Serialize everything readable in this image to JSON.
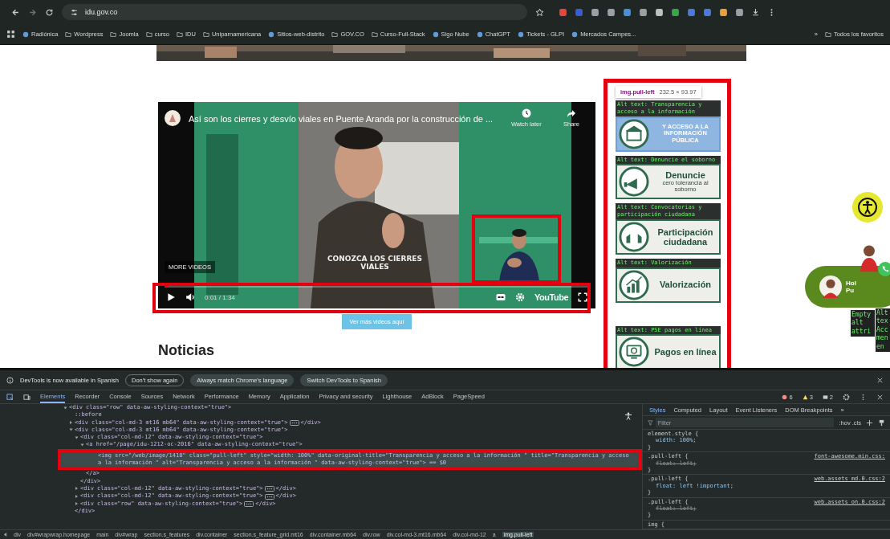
{
  "browser": {
    "url": "idu.gov.co",
    "bookmarks": [
      {
        "label": "Radiónica",
        "kind": "site"
      },
      {
        "label": "Wordpress",
        "kind": "folder"
      },
      {
        "label": "Joomla",
        "kind": "folder"
      },
      {
        "label": "curso",
        "kind": "folder"
      },
      {
        "label": "IDU",
        "kind": "folder"
      },
      {
        "label": "Uniparnamericana",
        "kind": "folder"
      },
      {
        "label": "Sitios-web-distrito",
        "kind": "site"
      },
      {
        "label": "GOV.CO",
        "kind": "folder"
      },
      {
        "label": "Curso-Full-Stack",
        "kind": "folder"
      },
      {
        "label": "Sigo Nube",
        "kind": "site"
      },
      {
        "label": "ChatGPT",
        "kind": "site"
      },
      {
        "label": "Tickets - GLPI",
        "kind": "site"
      },
      {
        "label": "Mercados Campes...",
        "kind": "site"
      }
    ],
    "overflow": "»",
    "all_bookmarks": "Todos los favoritos"
  },
  "page": {
    "video": {
      "title": "Así son los cierres y desvío viales en Puente Aranda por la construcción de ...",
      "watch_later": "Watch later",
      "share": "Share",
      "more_videos": "MORE VIDEOS",
      "caption": "CONOZCA LOS CIERRES VIALES",
      "time": "0:01 / 1:34",
      "brand": "YouTube",
      "level": 0.01
    },
    "more_button": "Ver más videos aquí",
    "heading": "Noticias",
    "inspector_tooltip": {
      "selector": "img.pull-left",
      "size": "232.5 × 93.97"
    },
    "cards": [
      {
        "alt": "Alt text: Transparencia y acceso a la información",
        "subtitle": "Y ACCESO A LA INFORMACIÓN PÚBLICA",
        "selected": true
      },
      {
        "alt": "Alt text: Denuncie el soborno",
        "title": "Denuncie",
        "subtitle": "cero tolerancia al soborno",
        "selected": false
      },
      {
        "alt": "Alt text: Convocatorias y participación ciudadana",
        "title": "Participación ciudadana",
        "selected": false
      },
      {
        "alt": "Alt text: Valorización",
        "title": "Valorización",
        "selected": false
      },
      {
        "alt": "Alt text: PSE pagos en línea",
        "title": "Pagos en línea",
        "selected": false
      }
    ],
    "chat": {
      "greeting": "Hol",
      "line": "Pu",
      "overlays": [
        "Empty alt attri",
        "Alt tex Acc men en"
      ]
    }
  },
  "devtools": {
    "notice": {
      "text": "DevTools is now available in Spanish",
      "buttons": [
        "Don't show again",
        "Always match Chrome's language",
        "Switch DevTools to Spanish"
      ]
    },
    "tabs": [
      {
        "label": "Elements",
        "selected": true
      },
      {
        "label": "Recorder",
        "selected": false
      },
      {
        "label": "Console",
        "selected": false
      },
      {
        "label": "Sources",
        "selected": false
      },
      {
        "label": "Network",
        "selected": false
      },
      {
        "label": "Performance",
        "selected": false
      },
      {
        "label": "Memory",
        "selected": false
      },
      {
        "label": "Application",
        "selected": false
      },
      {
        "label": "Privacy and security",
        "selected": false
      },
      {
        "label": "Lighthouse",
        "selected": false
      },
      {
        "label": "AdBlock",
        "selected": false
      },
      {
        "label": "PageSpeed",
        "selected": false
      }
    ],
    "errors": "6",
    "warnings": "3",
    "infos": "2",
    "dom": [
      {
        "open": "<div class=\"row\" data-aw-styling-context=\"true\">",
        "expanded": true,
        "selected": false,
        "children": [
          {
            "open": "::before",
            "selected": false
          },
          {
            "open": "<div class=\"col-md-3 mt16 mb64\" data-aw-styling-context=\"true\">",
            "close": "</div>",
            "expanded": false,
            "selected": false
          },
          {
            "open": "<div class=\"col-md-3 mt16 mb64\" data-aw-styling-context=\"true\">",
            "close": "</div>",
            "expanded": true,
            "selected": false,
            "children": [
              {
                "open": "<div class=\"col-md-12\" data-aw-styling-context=\"true\">",
                "close": "</div>",
                "expanded": true,
                "selected": false,
                "children": [
                  {
                    "open": "<a href=\"/page/idu-1212-oc-2016\" data-aw-styling-context=\"true\">",
                    "close": "</a>",
                    "expanded": true,
                    "selected": false,
                    "children": [
                      {
                        "open": "<img src=\"/web/image/1418\" class=\"pull-left\" style=\"width: 100%\" data-original-title=\"Transparencia y acceso a la información \" title=\"Transparencia y acceso a la información \" alt=\"Transparencia y acceso a la información \" data-aw-styling-context=\"true\"> == $0",
                        "selected": true
                      }
                    ]
                  }
                ]
              },
              {
                "open": "<div class=\"col-md-12\" data-aw-styling-context=\"true\">",
                "close": "</div>",
                "expanded": false,
                "selected": false
              },
              {
                "open": "<div class=\"col-md-12\" data-aw-styling-context=\"true\">",
                "close": "</div>",
                "expanded": false,
                "selected": false
              },
              {
                "open": "<div class=\"row\" data-aw-styling-context=\"true\">",
                "close": "</div>",
                "expanded": false,
                "selected": false
              }
            ]
          }
        ]
      }
    ],
    "styles_tabs": [
      {
        "label": "Styles",
        "selected": true
      },
      {
        "label": "Computed",
        "selected": false
      },
      {
        "label": "Layout",
        "selected": false
      },
      {
        "label": "Event Listeners",
        "selected": false
      },
      {
        "label": "DOM Breakpoints",
        "selected": false
      }
    ],
    "more_tabs": "»",
    "filter_placeholder": "Filter",
    "filter_tools": ":hov .cls",
    "rules": [
      {
        "open": "element.style {",
        "declarations": [
          {
            "text": "width: 100%;",
            "overridden": false
          }
        ],
        "close": "}"
      },
      {
        "open": ".pull-left {",
        "source": "font-awesome.min.css:",
        "declarations": [
          {
            "text": "float: left;",
            "overridden": true
          }
        ],
        "close": "}"
      },
      {
        "open": ".pull-left {",
        "source": "web.assets_md.0.css:2",
        "declarations": [
          {
            "text": "float: left !important;",
            "overridden": false
          }
        ],
        "close": "}"
      },
      {
        "open": ".pull-left {",
        "source": "web.assets_on.0.css:2",
        "declarations": [
          {
            "text": "float: left;",
            "overridden": true
          }
        ],
        "close": "}"
      },
      {
        "open": "img {"
      }
    ],
    "breadcrumbs": [
      {
        "label": "div",
        "selected": false
      },
      {
        "label": "div#wrapwrap.homepage",
        "selected": false
      },
      {
        "label": "main",
        "selected": false
      },
      {
        "label": "div#wrap",
        "selected": false
      },
      {
        "label": "section.s_features",
        "selected": false
      },
      {
        "label": "div.container",
        "selected": false
      },
      {
        "label": "section.s_feature_grid.mt16",
        "selected": false
      },
      {
        "label": "div.container.mb64",
        "selected": false
      },
      {
        "label": "div.row",
        "selected": false
      },
      {
        "label": "div.col-md-3.mt16.mb64",
        "selected": false
      },
      {
        "label": "div.col-md-12",
        "selected": false
      },
      {
        "label": "a",
        "selected": false
      },
      {
        "label": "img.pull-left",
        "selected": true
      }
    ]
  }
}
